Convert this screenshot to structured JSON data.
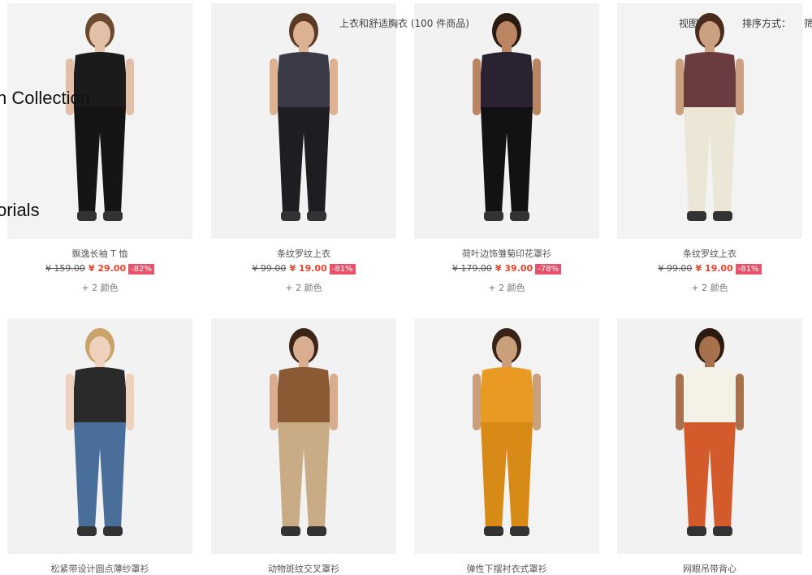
{
  "header": {
    "title": "上衣和舒适胸衣 (100 件商品)",
    "view_label": "视图",
    "sort_label": "排序方式：",
    "sort_value": "筛"
  },
  "side_menu": {
    "item1": "n Collection",
    "item2": "orials"
  },
  "products": [
    {
      "name": "飘逸长袖 T 恤",
      "old_price": "¥ 159.00",
      "new_price": "¥ 29.00",
      "discount": "-82%",
      "colors": "+ 2 颜色",
      "colors_hex": {
        "top": "#1b1b1b",
        "bottom": "#151515",
        "skin": "#e2bfa6",
        "hair": "#6b4a2f",
        "bg": "#f3f3f3"
      }
    },
    {
      "name": "条纹罗纹上衣",
      "old_price": "¥ 99.00",
      "new_price": "¥ 19.00",
      "discount": "-81%",
      "colors": "+ 2 颜色",
      "colors_hex": {
        "top": "#3b3b48",
        "bottom": "#1e1e22",
        "skin": "#dcb293",
        "hair": "#5a3a26",
        "bg": "#f2f2f2"
      }
    },
    {
      "name": "荷叶边饰雏菊印花罩衫",
      "old_price": "¥ 179.00",
      "new_price": "¥ 39.00",
      "discount": "-78%",
      "colors": "+ 2 颜色",
      "colors_hex": {
        "top": "#2a2230",
        "bottom": "#121212",
        "skin": "#b98563",
        "hair": "#2a1a12",
        "bg": "#f2f2f2"
      }
    },
    {
      "name": "条纹罗纹上衣",
      "old_price": "¥ 99.00",
      "new_price": "¥ 19.00",
      "discount": "-81%",
      "colors": "+ 2 颜色",
      "colors_hex": {
        "top": "#6a3c40",
        "bottom": "#ece6d6",
        "skin": "#caa080",
        "hair": "#4a2c1c",
        "bg": "#f3f3f3"
      }
    },
    {
      "name": "松紧带设计圆点薄纱罩衫",
      "colors_hex": {
        "top": "#2a2a2a",
        "bottom": "#4a6e9a",
        "skin": "#efd2bd",
        "hair": "#c9a36a",
        "bg": "#f2f2f2"
      }
    },
    {
      "name": "动物斑纹交叉罩衫",
      "colors_hex": {
        "top": "#8a5a34",
        "bottom": "#c9ac85",
        "skin": "#d8ad90",
        "hair": "#3c2618",
        "bg": "#f2f2f2"
      }
    },
    {
      "name": "弹性下摆衬衣式罩衫",
      "colors_hex": {
        "top": "#e89a22",
        "bottom": "#d88a16",
        "skin": "#caa07a",
        "hair": "#3a2418",
        "bg": "#f3f3f3"
      }
    },
    {
      "name": "网眼吊带背心",
      "colors_hex": {
        "top": "#f4f1e6",
        "bottom": "#d35a2a",
        "skin": "#a8714e",
        "hair": "#2b1a10",
        "bg": "#f2f2f2"
      }
    }
  ]
}
